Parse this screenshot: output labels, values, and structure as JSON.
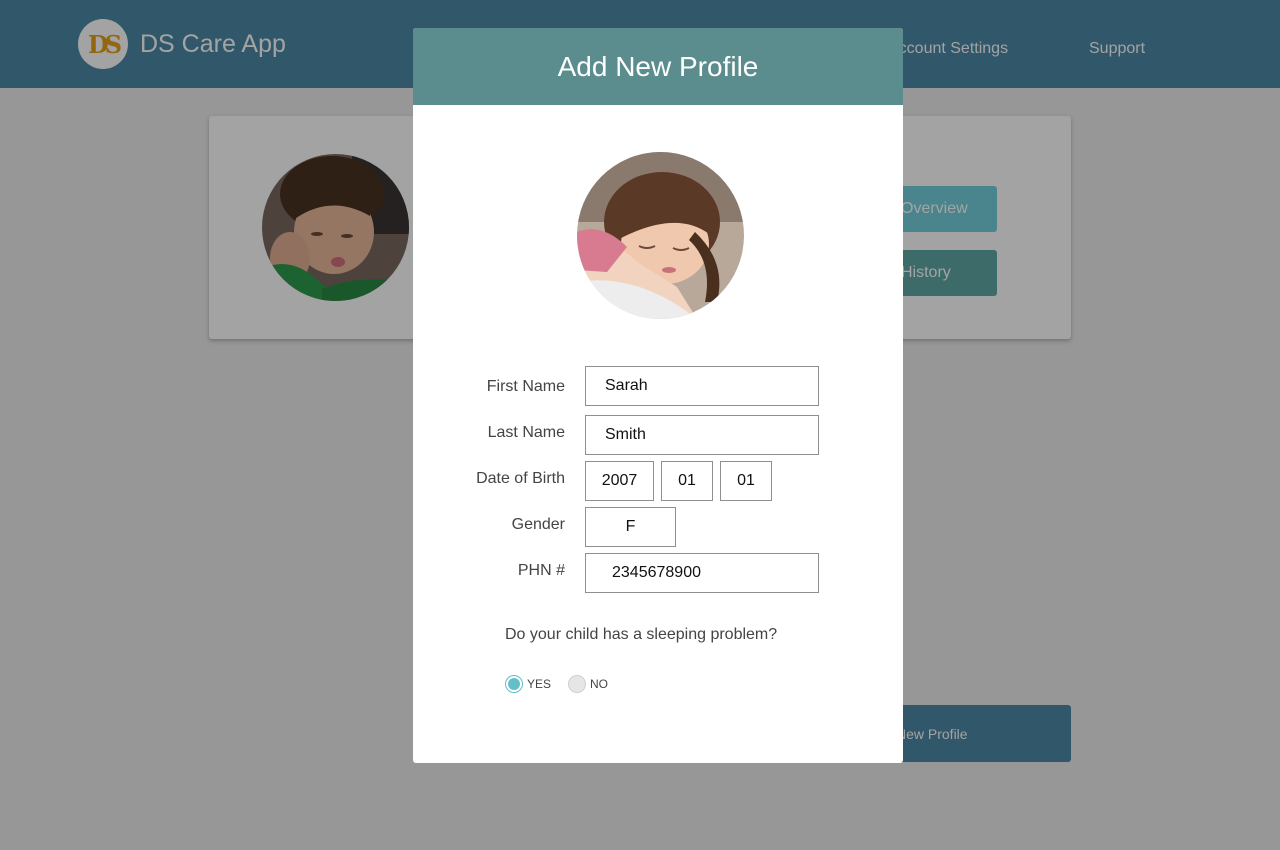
{
  "app": {
    "logo_text": "DS",
    "title": "DS Care App"
  },
  "nav": {
    "account_settings": "Account Settings",
    "support": "Support"
  },
  "profile_card": {
    "overview_button": "Overview",
    "history_button": "History"
  },
  "new_profile_button": "New Profile",
  "modal": {
    "title": "Add New Profile",
    "fields": {
      "first_name": {
        "label": "First Name",
        "value": "Sarah"
      },
      "last_name": {
        "label": "Last Name",
        "value": "Smith"
      },
      "dob": {
        "label": "Date of Birth",
        "year": "2007",
        "month": "01",
        "day": "01"
      },
      "gender": {
        "label": "Gender",
        "value": "F"
      },
      "phn": {
        "label": "PHN #",
        "value": "2345678900"
      }
    },
    "question": "Do your child has a sleeping problem?",
    "options": {
      "yes": "YES",
      "no": "NO",
      "selected": "yes"
    }
  },
  "colors": {
    "header": "#4d88a6",
    "modal_header": "#5b8c8e",
    "accent": "#64bfc9"
  }
}
